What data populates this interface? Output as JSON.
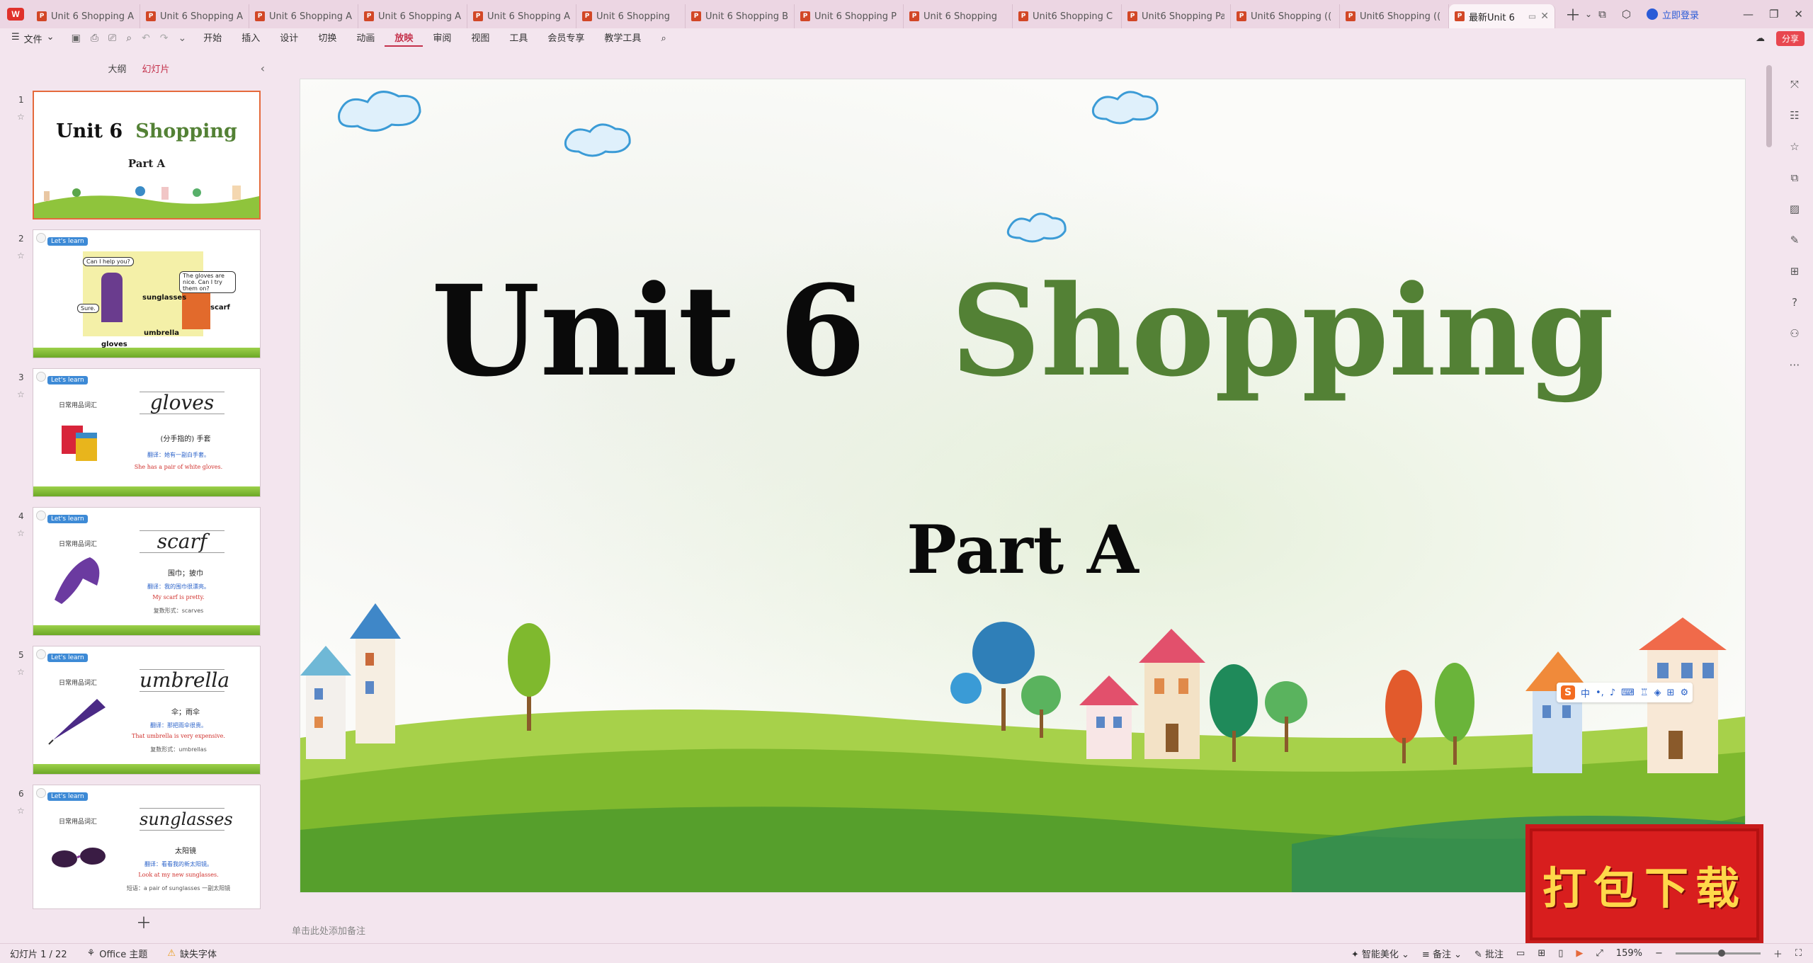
{
  "tabbar": {
    "tabs": [
      {
        "label": "Unit 6 Shopping A"
      },
      {
        "label": "Unit 6 Shopping A"
      },
      {
        "label": "Unit 6 Shopping A"
      },
      {
        "label": "Unit 6 Shopping A"
      },
      {
        "label": "Unit 6 Shopping A"
      },
      {
        "label": "Unit 6 Shopping"
      },
      {
        "label": "Unit 6 Shopping B"
      },
      {
        "label": "Unit 6 Shopping P"
      },
      {
        "label": "Unit 6 Shopping"
      },
      {
        "label": "Unit6 Shopping C"
      },
      {
        "label": "Unit6 Shopping Pa"
      },
      {
        "label": "Unit6 Shopping (("
      },
      {
        "label": "Unit6 Shopping (("
      }
    ],
    "active_tab": {
      "label": "最新Unit 6"
    },
    "login_label": "立即登录"
  },
  "menu": {
    "file": "文件",
    "items": [
      "开始",
      "插入",
      "设计",
      "切换",
      "动画",
      "放映",
      "审阅",
      "视图",
      "工具",
      "会员专享",
      "教学工具"
    ],
    "active": "放映",
    "share": "分享"
  },
  "leftpanel": {
    "tab_outline": "大纲",
    "tab_slides": "幻灯片",
    "slides": [
      {
        "num": "1",
        "title_unit": "Unit 6",
        "title_word": "Shopping",
        "part": "Part A"
      },
      {
        "num": "2",
        "tag": "Let's learn",
        "bubble1": "Can I help you?",
        "bubble2": "The gloves are nice. Can I try them on?",
        "bubble3": "Sure.",
        "labels": [
          "sunglasses",
          "scarf",
          "umbrella",
          "gloves"
        ]
      },
      {
        "num": "3",
        "tag": "Let's learn",
        "category": "日常用品词汇",
        "word": "gloves",
        "meaning": "(分手指的) 手套",
        "translate": "翻译：她有一副白手套。",
        "example": "She has a pair of white gloves."
      },
      {
        "num": "4",
        "tag": "Let's learn",
        "category": "日常用品词汇",
        "word": "scarf",
        "meaning": "围巾；披巾",
        "translate": "翻译：我的围巾很漂亮。",
        "example": "My scarf is pretty.",
        "plural": "复数形式：scarves"
      },
      {
        "num": "5",
        "tag": "Let's learn",
        "category": "日常用品词汇",
        "word": "umbrella",
        "meaning": "伞；雨伞",
        "translate": "翻译：那把雨伞很贵。",
        "example": "That umbrella is very expensive.",
        "plural": "复数形式：umbrellas"
      },
      {
        "num": "6",
        "tag": "Let's learn",
        "category": "日常用品词汇",
        "word": "sunglasses",
        "meaning": "太阳镜",
        "translate": "翻译：看看我的新太阳镜。",
        "example": "Look at my new sunglasses.",
        "plural": "短语：a pair of sunglasses 一副太阳镜"
      }
    ]
  },
  "slide": {
    "title_unit": "Unit 6",
    "title_word": "Shopping",
    "subtitle": "Part A"
  },
  "notes_placeholder": "单击此处添加备注",
  "ime": {
    "mode": "中"
  },
  "stamp": "打包下载",
  "status": {
    "slide_info": "幻灯片 1 / 22",
    "theme": "Office 主题",
    "missing_font": "缺失字体",
    "beautify": "智能美化",
    "notes": "备注",
    "comments": "批注",
    "zoom": "159%",
    "zoom_level": 0.55
  },
  "colors": {
    "accent": "#c4314b",
    "title_green": "#538135",
    "stamp_red": "#d81e1e",
    "stamp_text": "#ffd84a"
  }
}
